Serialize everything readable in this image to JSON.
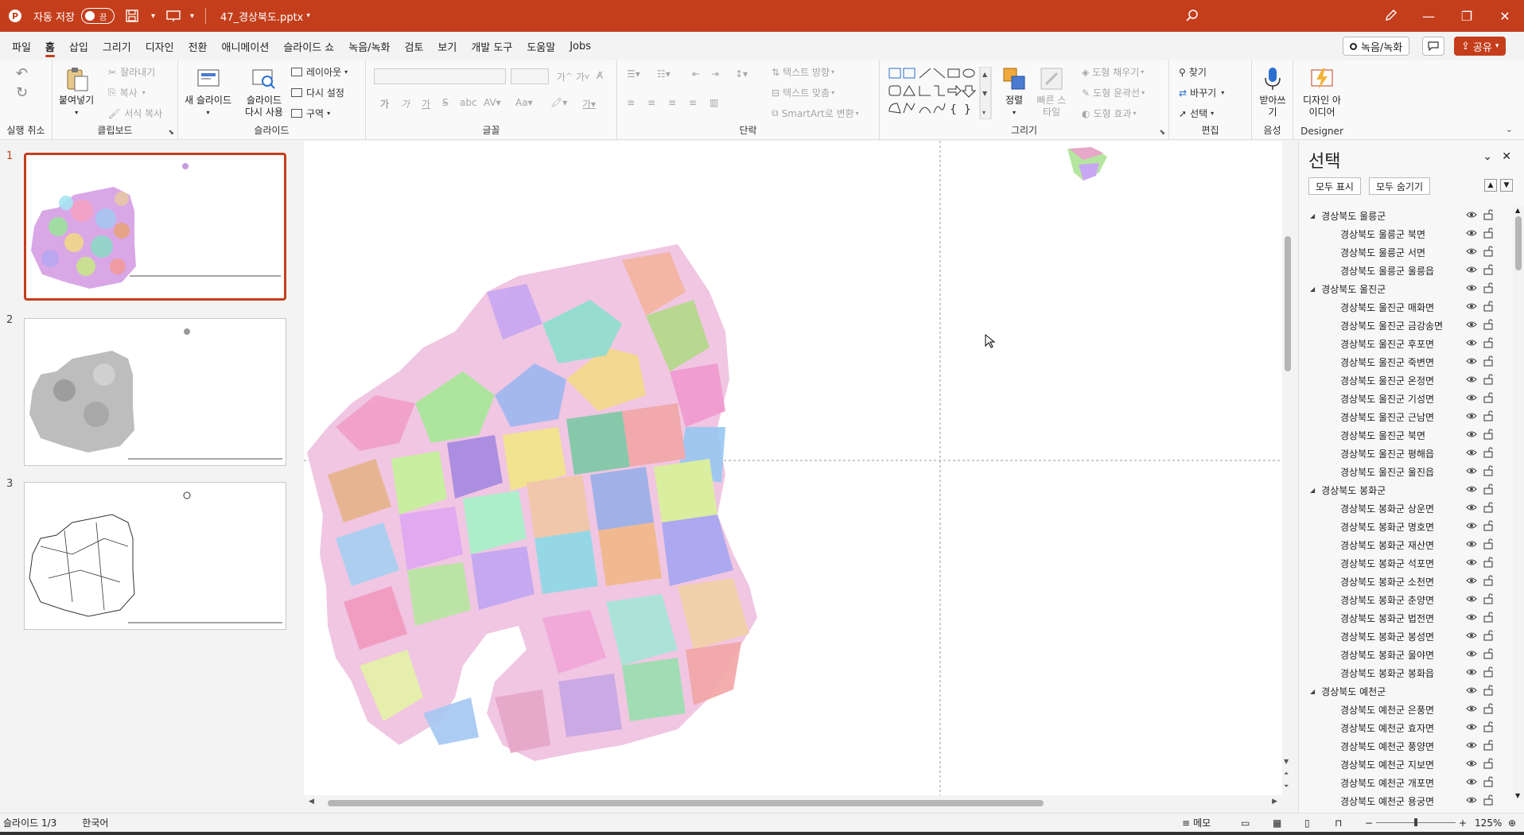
{
  "titlebar": {
    "autosave_label": "자동 저장",
    "autosave_state": "끔",
    "filename": "47_경상북도.pptx"
  },
  "menu": {
    "tabs": [
      "파일",
      "홈",
      "삽입",
      "그리기",
      "디자인",
      "전환",
      "애니메이션",
      "슬라이드 쇼",
      "녹음/녹화",
      "검토",
      "보기",
      "개발 도구",
      "도움말",
      "Jobs"
    ],
    "active_index": 1,
    "record_label": "녹음/녹화",
    "share_label": "공유"
  },
  "ribbon": {
    "undo_group": "실행 취소",
    "clipboard": {
      "label": "클립보드",
      "paste": "붙여넣기",
      "cut": "잘라내기",
      "copy": "복사",
      "format_painter": "서식 복사"
    },
    "slides": {
      "label": "슬라이드",
      "new_slide": "새 슬라이드",
      "reuse": "슬라이드 다시 사용",
      "layout": "레이아웃",
      "reset": "다시 설정",
      "section": "구역"
    },
    "font": {
      "label": "글꼴",
      "bold": "가",
      "italic": "가",
      "underline": "가",
      "strike": "S"
    },
    "paragraph": {
      "label": "단락",
      "text_dir": "텍스트 방향",
      "align_text": "텍스트 맞춤",
      "smartart": "SmartArt로 변환"
    },
    "drawing": {
      "label": "그리기",
      "arrange": "정렬",
      "quick_styles": "빠른 스타일",
      "fill": "도형 채우기",
      "outline": "도형 윤곽선",
      "effects": "도형 효과"
    },
    "editing": {
      "label": "편집",
      "find": "찾기",
      "replace": "바꾸기",
      "select": "선택"
    },
    "voice": {
      "label": "음성",
      "dictate": "받아쓰기"
    },
    "designer": {
      "label": "Designer",
      "ideas": "디자인 아이디어"
    }
  },
  "thumbnails": [
    "1",
    "2",
    "3"
  ],
  "selection_pane": {
    "title": "선택",
    "show_all": "모두 표시",
    "hide_all": "모두 숨기기",
    "items": [
      {
        "label": "경상북도 울릉군",
        "level": 0
      },
      {
        "label": "경상북도 울릉군 북면",
        "level": 1
      },
      {
        "label": "경상북도 울릉군 서면",
        "level": 1
      },
      {
        "label": "경상북도 울릉군 울릉읍",
        "level": 1
      },
      {
        "label": "경상북도 울진군",
        "level": 0
      },
      {
        "label": "경상북도 울진군 매화면",
        "level": 1
      },
      {
        "label": "경상북도 울진군 금강송면",
        "level": 1
      },
      {
        "label": "경상북도 울진군 후포면",
        "level": 1
      },
      {
        "label": "경상북도 울진군 죽변면",
        "level": 1
      },
      {
        "label": "경상북도 울진군 온정면",
        "level": 1
      },
      {
        "label": "경상북도 울진군 기성면",
        "level": 1
      },
      {
        "label": "경상북도 울진군 근남면",
        "level": 1
      },
      {
        "label": "경상북도 울진군 북면",
        "level": 1
      },
      {
        "label": "경상북도 울진군 평해읍",
        "level": 1
      },
      {
        "label": "경상북도 울진군 울진읍",
        "level": 1
      },
      {
        "label": "경상북도 봉화군",
        "level": 0
      },
      {
        "label": "경상북도 봉화군 상운면",
        "level": 1
      },
      {
        "label": "경상북도 봉화군 명호면",
        "level": 1
      },
      {
        "label": "경상북도 봉화군 재산면",
        "level": 1
      },
      {
        "label": "경상북도 봉화군 석포면",
        "level": 1
      },
      {
        "label": "경상북도 봉화군 소천면",
        "level": 1
      },
      {
        "label": "경상북도 봉화군 춘양면",
        "level": 1
      },
      {
        "label": "경상북도 봉화군 법전면",
        "level": 1
      },
      {
        "label": "경상북도 봉화군 봉성면",
        "level": 1
      },
      {
        "label": "경상북도 봉화군 물야면",
        "level": 1
      },
      {
        "label": "경상북도 봉화군 봉화읍",
        "level": 1
      },
      {
        "label": "경상북도 예천군",
        "level": 0
      },
      {
        "label": "경상북도 예천군 은풍면",
        "level": 1
      },
      {
        "label": "경상북도 예천군 효자면",
        "level": 1
      },
      {
        "label": "경상북도 예천군 풍양면",
        "level": 1
      },
      {
        "label": "경상북도 예천군 지보면",
        "level": 1
      },
      {
        "label": "경상북도 예천군 개포면",
        "level": 1
      },
      {
        "label": "경상북도 예천군 용궁면",
        "level": 1
      }
    ]
  },
  "status": {
    "slide_info": "슬라이드 1/3",
    "language": "한국어",
    "notes": "메모",
    "zoom": "125%"
  }
}
